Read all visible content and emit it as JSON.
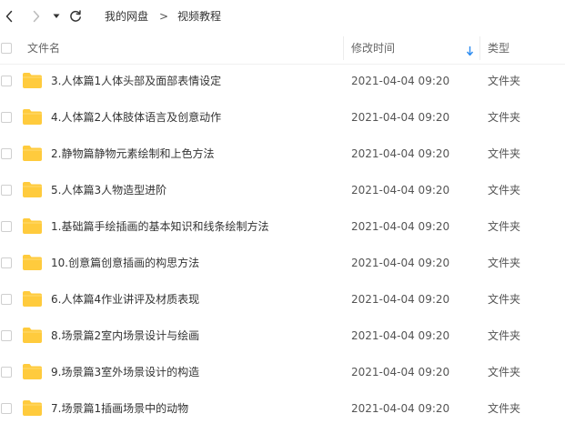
{
  "breadcrumb": {
    "root": "我的网盘",
    "separator": ">",
    "current": "视频教程"
  },
  "columns": {
    "name": "文件名",
    "time": "修改时间",
    "type": "类型"
  },
  "icons": {
    "back": "chevron-left-icon",
    "forward": "chevron-right-icon",
    "history": "caret-down-icon",
    "refresh": "refresh-icon",
    "sort": "arrow-down-icon",
    "folder": "folder-icon"
  },
  "colors": {
    "folder": "#FFCB3D",
    "sort_arrow": "#2D8CF0"
  },
  "files": [
    {
      "name": "3.人体篇1人体头部及面部表情设定",
      "time": "2021-04-04 09:20",
      "type": "文件夹"
    },
    {
      "name": "4.人体篇2人体肢体语言及创意动作",
      "time": "2021-04-04 09:20",
      "type": "文件夹"
    },
    {
      "name": "2.静物篇静物元素绘制和上色方法",
      "time": "2021-04-04 09:20",
      "type": "文件夹"
    },
    {
      "name": "5.人体篇3人物造型进阶",
      "time": "2021-04-04 09:20",
      "type": "文件夹"
    },
    {
      "name": "1.基础篇手绘插画的基本知识和线条绘制方法",
      "time": "2021-04-04 09:20",
      "type": "文件夹"
    },
    {
      "name": "10.创意篇创意插画的构思方法",
      "time": "2021-04-04 09:20",
      "type": "文件夹"
    },
    {
      "name": "6.人体篇4作业讲评及材质表现",
      "time": "2021-04-04 09:20",
      "type": "文件夹"
    },
    {
      "name": "8.场景篇2室内场景设计与绘画",
      "time": "2021-04-04 09:20",
      "type": "文件夹"
    },
    {
      "name": "9.场景篇3室外场景设计的构造",
      "time": "2021-04-04 09:20",
      "type": "文件夹"
    },
    {
      "name": "7.场景篇1插画场景中的动物",
      "time": "2021-04-04 09:20",
      "type": "文件夹"
    }
  ]
}
